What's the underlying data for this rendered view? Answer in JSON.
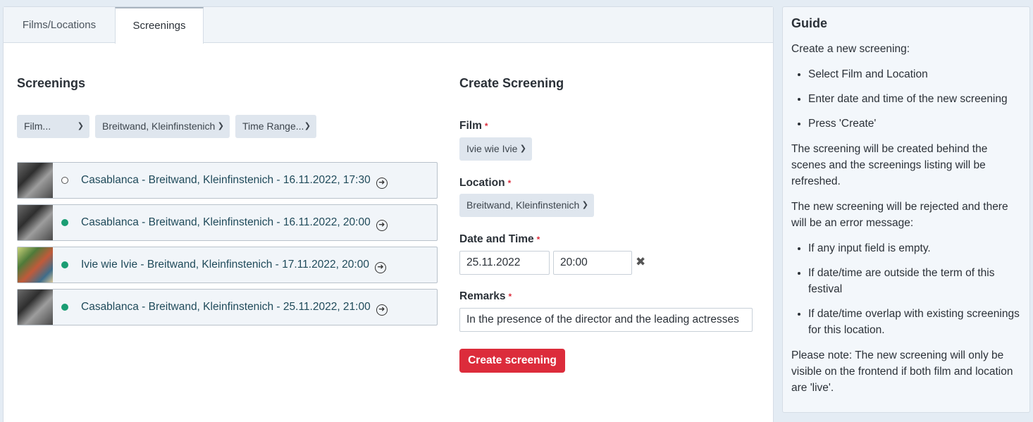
{
  "tabs": [
    {
      "label": "Films/Locations"
    },
    {
      "label": "Screenings"
    }
  ],
  "screenings_section": {
    "title": "Screenings",
    "filters": {
      "film": "Film...",
      "location": "Breitwand, Kleinfinstenich",
      "time_range": "Time Range..."
    },
    "items": [
      {
        "label": "Casablanca - Breitwand, Kleinfinstenich - 16.11.2022, 17:30",
        "status": "open"
      },
      {
        "label": "Casablanca - Breitwand, Kleinfinstenich - 16.11.2022, 20:00",
        "status": "live"
      },
      {
        "label": "Ivie wie Ivie - Breitwand, Kleinfinstenich - 17.11.2022, 20:00",
        "status": "live"
      },
      {
        "label": "Casablanca - Breitwand, Kleinfinstenich - 25.11.2022, 21:00",
        "status": "live"
      }
    ]
  },
  "create_section": {
    "title": "Create Screening",
    "film_label": "Film",
    "film_value": "Ivie wie Ivie",
    "location_label": "Location",
    "location_value": "Breitwand, Kleinfinstenich",
    "datetime_label": "Date and Time",
    "date_value": "25.11.2022",
    "time_value": "20:00",
    "remarks_label": "Remarks",
    "remarks_value": "In the presence of the director and the leading actresses",
    "required_mark": "*",
    "submit_label": "Create screening"
  },
  "guide": {
    "title": "Guide",
    "intro": "Create a new screening:",
    "steps": [
      "Select Film and Location",
      "Enter date and time of the new screening",
      "Press 'Create'"
    ],
    "para1": "The screening will be created behind the scenes and the screenings listing will be refreshed.",
    "para2": "The new screening will be rejected and there will be an error message:",
    "errors": [
      "If any input field is empty.",
      "If date/time are outside the term of this festival",
      "If date/time overlap with existing screenings for this location."
    ],
    "note": "Please note: The new screening will only be visible on the frontend if both film and location are 'live'."
  },
  "colors": {
    "accent": "#dc2c3b",
    "live": "#1a9d73",
    "link_text": "#1f4a5a"
  }
}
